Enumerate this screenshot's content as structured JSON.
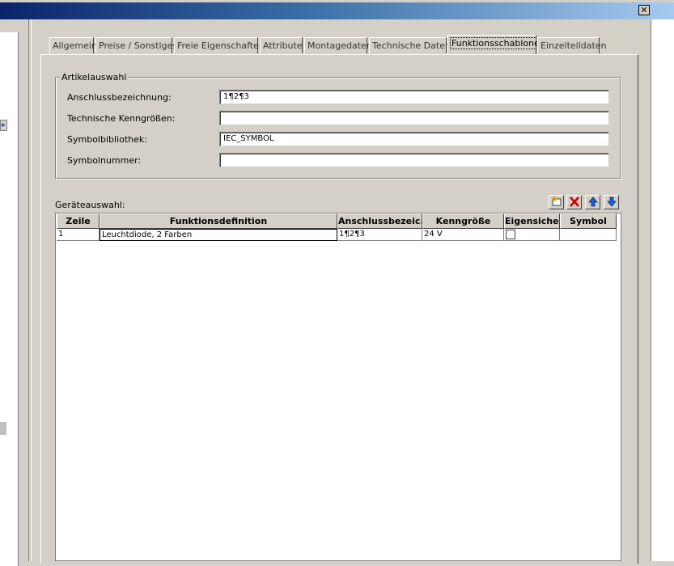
{
  "window": {
    "close_symbol": "✕"
  },
  "left_panel": {
    "arrow_symbol": "▸"
  },
  "tabs": [
    {
      "label": "Allgemein"
    },
    {
      "label": "Preise / Sonstiges"
    },
    {
      "label": "Freie Eigenschaften"
    },
    {
      "label": "Attribute"
    },
    {
      "label": "Montagedaten"
    },
    {
      "label": "Technische Daten"
    },
    {
      "label": "Funktionsschablone"
    },
    {
      "label": "Einzelteildaten"
    }
  ],
  "active_tab": "Funktionsschablone",
  "article_selection": {
    "title": "Artikelauswahl",
    "fields": [
      {
        "label": "Anschlussbezeichnung:",
        "value": "1¶2¶3"
      },
      {
        "label": "Technische Kenngrößen:",
        "value": ""
      },
      {
        "label": "Symbolbibliothek:",
        "value": "IEC_SYMBOL"
      },
      {
        "label": "Symbolnummer:",
        "value": ""
      }
    ]
  },
  "device_selection": {
    "label": "Geräteauswahl:",
    "toolbar": {
      "new_icon": "new-row-icon",
      "delete_icon": "delete-icon",
      "up_icon": "arrow-up-icon",
      "down_icon": "arrow-down-icon"
    },
    "columns": [
      "Zeile",
      "Funktionsdefinition",
      "Anschlussbezeic...",
      "Kenngröße",
      "Eigensicher",
      "Symbol"
    ],
    "rows": [
      {
        "zeile": "1",
        "funktionsdefinition": "Leuchtdiode, 2 Farben",
        "anschluss": "1¶2¶3",
        "kenngroesse": "24 V",
        "eigensicher": false,
        "symbol": ""
      }
    ]
  },
  "colors": {
    "title_start": "#0a246a",
    "title_end": "#a6caf0",
    "face": "#d4d0c8",
    "delete_red": "#cc0000",
    "arrow_blue": "#1e5fd0"
  }
}
